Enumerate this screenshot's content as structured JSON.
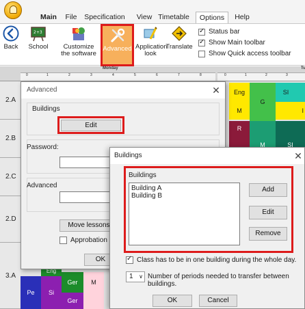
{
  "ribbon": {
    "tabs": [
      "Main",
      "File",
      "Specification",
      "View",
      "Timetable",
      "Options",
      "Help"
    ],
    "selected_tab": "Options",
    "buttons": {
      "back": "Back",
      "school": "School",
      "customize": "Customize the software",
      "advanced": "Advanced",
      "application_look": "Application look",
      "translate": "Translate"
    },
    "checkboxes": [
      {
        "label": "Status bar",
        "checked": true
      },
      {
        "label": "Show Main toolbar",
        "checked": true
      },
      {
        "label": "Show Quick access toolbar",
        "checked": false
      }
    ]
  },
  "timetable": {
    "day": "Monday",
    "day_right": "Tu",
    "periods": [
      "0",
      "1",
      "2",
      "3",
      "4",
      "5",
      "6",
      "7",
      "8"
    ],
    "periods_right": [
      "0",
      "1",
      "2",
      "3"
    ],
    "rows": [
      "2.A",
      "2.B",
      "2.C",
      "2.D",
      "3.A"
    ],
    "cells": {
      "eng": "Eng",
      "g": "G",
      "si": "SI",
      "m": "M",
      "i": "I",
      "r": "R",
      "m2": "M",
      "si2": "SI",
      "eng_3a": "Eng",
      "ger1": "Ger",
      "m_3a": "M",
      "pe": "Pe",
      "si_3a": "Si",
      "ger2": "Ger"
    }
  },
  "advanced_dialog": {
    "title": "Advanced",
    "buildings_group": "Buildings",
    "edit_button": "Edit",
    "password_label": "Password:",
    "password_value": "",
    "advanced_group": "Advanced",
    "advanced_value": "",
    "move_lessons_button": "Move lessons",
    "approbation_label": "Approbation",
    "approbation_checked": false,
    "ok_button": "OK"
  },
  "buildings_dialog": {
    "title": "Buildings",
    "list_label": "Buildings",
    "items": [
      "Building A",
      "Building B"
    ],
    "add_button": "Add",
    "edit_button": "Edit",
    "remove_button": "Remove",
    "one_building_label": "Class has to be in one building during the whole day.",
    "one_building_checked": true,
    "periods_value": "1",
    "periods_label": "Number of periods needed to transfer between buildings.",
    "ok_button": "OK",
    "cancel_button": "Cancel"
  },
  "colors": {
    "highlight": "#dd1b1b",
    "advanced_button_bg": "#f7b05c"
  }
}
